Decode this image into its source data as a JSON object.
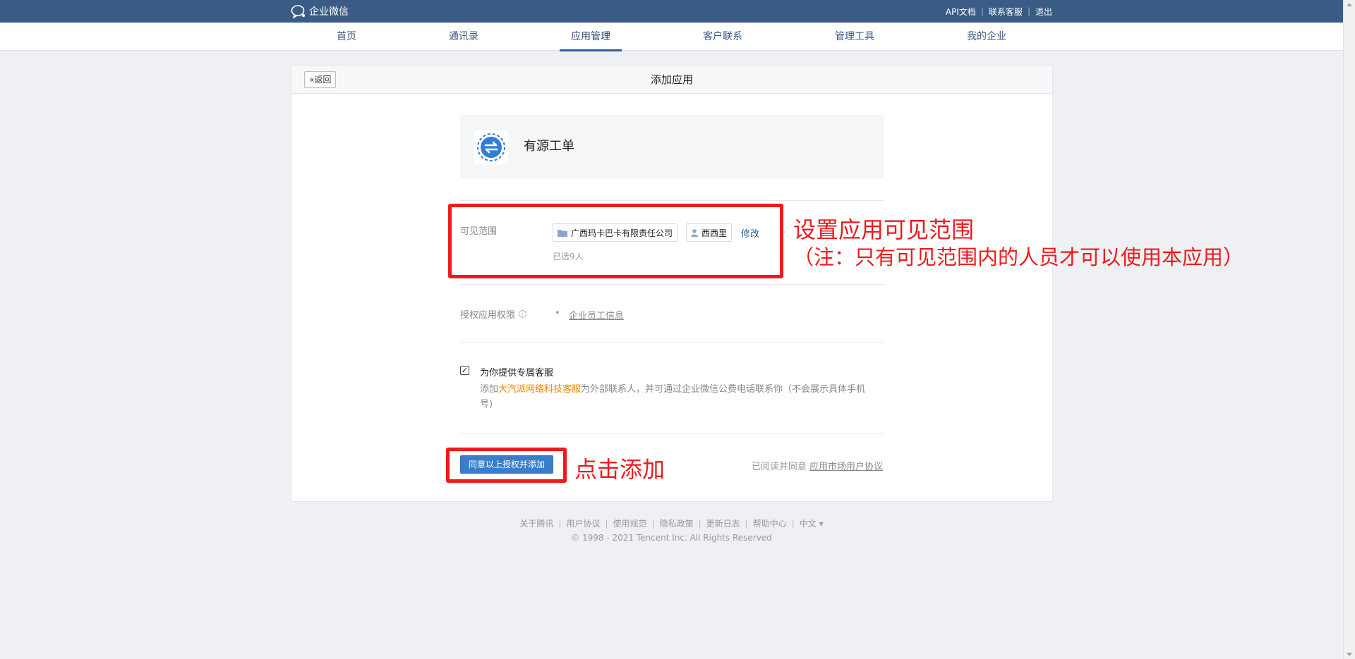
{
  "header": {
    "brand": "企业微信",
    "links": [
      "API文档",
      "联系客服",
      "退出"
    ]
  },
  "nav": {
    "items": [
      "首页",
      "通讯录",
      "应用管理",
      "客户联系",
      "管理工具",
      "我的企业"
    ],
    "active": "应用管理"
  },
  "card": {
    "back_label": "«返回",
    "title": "添加应用"
  },
  "app": {
    "name": "有源工单",
    "icon": "swap-circle-icon"
  },
  "visibility": {
    "label": "可见范围",
    "org_tag": "广西玛卡巴卡有限责任公司",
    "user_tag": "西西里",
    "edit_label": "修改",
    "selected_count": "已选9人"
  },
  "permissions": {
    "label": "授权应用权限",
    "items": [
      "企业员工信息"
    ]
  },
  "support": {
    "checked": true,
    "title": "为你提供专属客服",
    "desc_prefix": "添加",
    "desc_highlight": "大汽派网络科技客服",
    "desc_suffix": "为外部联系人，并可通过企业微信公费电话联系你（不会展示具体手机号)"
  },
  "actions": {
    "submit_label": "同意以上授权并添加",
    "agree_prefix": "已阅读并同意",
    "agree_link": "应用市场用户协议"
  },
  "annotations": {
    "visibility_title": "设置应用可见范围",
    "visibility_note": "（注：只有可见范围内的人员才可以使用本应用）",
    "submit_note": "点击添加"
  },
  "footer": {
    "links": [
      "关于腾讯",
      "用户协议",
      "使用规范",
      "隐私政策",
      "更新日志",
      "帮助中心",
      "中文 ▾"
    ],
    "copyright": "© 1998 - 2021 Tencent Inc. All Rights Reserved"
  },
  "colors": {
    "topbar": "#3a5b85",
    "primary": "#3a7ec9",
    "annotation": "#f0191c",
    "highlight": "#f08300"
  }
}
